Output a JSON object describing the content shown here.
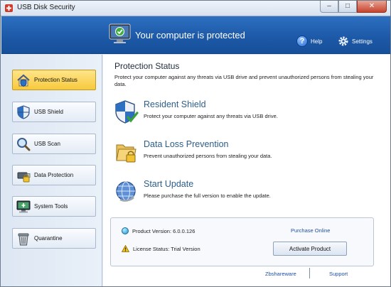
{
  "window": {
    "title": "USB Disk Security",
    "controls": {
      "minimize": "–",
      "maximize": "□",
      "close": "✕"
    }
  },
  "header": {
    "status_text": "Your computer is protected",
    "help_label": "Help",
    "settings_label": "Settings",
    "accent_color": "#1f5ea9"
  },
  "sidebar": {
    "items": [
      {
        "label": "Protection Status",
        "icon": "house-shield-icon",
        "active": true
      },
      {
        "label": "USB Shield",
        "icon": "shield-icon",
        "active": false
      },
      {
        "label": "USB Scan",
        "icon": "magnifier-icon",
        "active": false
      },
      {
        "label": "Data Protection",
        "icon": "usb-drive-lock-icon",
        "active": false
      },
      {
        "label": "System Tools",
        "icon": "monitor-tools-icon",
        "active": false
      },
      {
        "label": "Quarantine",
        "icon": "trash-bin-icon",
        "active": false
      }
    ]
  },
  "main": {
    "title": "Protection Status",
    "description": "Protect your computer against any threats via USB drive and prevent unauthorized persons from stealing your data.",
    "features": [
      {
        "title": "Resident Shield",
        "description": "Protect your computer against any threats via USB drive.",
        "icon": "shield-check-icon"
      },
      {
        "title": "Data Loss Prevention",
        "description": "Prevent unauthorized persons from stealing your data.",
        "icon": "folder-lock-icon"
      },
      {
        "title": "Start Update",
        "description": "Please purchase the full version to enable the update.",
        "icon": "globe-update-icon"
      }
    ],
    "info": {
      "version": "Product Version: 6.0.0.126",
      "license": "License Status: Trial Version",
      "purchase_link": "Purchase Online",
      "activate_button": "Activate Product"
    },
    "footer": {
      "vendor_link": "Zbshareware",
      "support_link": "Support"
    }
  }
}
